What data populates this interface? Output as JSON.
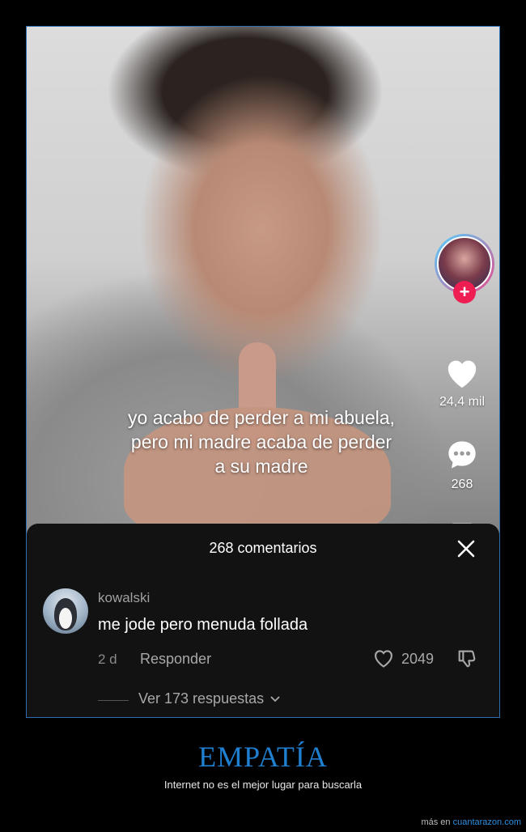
{
  "video": {
    "caption": "yo acabo de perder a mi abuela, pero mi madre acaba de perder a su madre"
  },
  "rail": {
    "follow_symbol": "+",
    "likes": "24,4 mil",
    "comments": "268"
  },
  "comments_panel": {
    "title": "268 comentarios",
    "comment": {
      "username": "kowalski",
      "text": "me jode pero menuda follada",
      "age": "2 d",
      "reply_label": "Responder",
      "like_count": "2049",
      "view_replies": "Ver 173 respuestas"
    }
  },
  "banner": {
    "headline": "EMPATÍA",
    "subline": "Internet no es el mejor lugar para buscarla",
    "footer_prefix": "más en",
    "footer_site": "cuantarazon.com"
  },
  "colors": {
    "accent_blue": "#1f7fd0",
    "follow_red": "#ee1d52",
    "sheet_bg": "#121212"
  }
}
